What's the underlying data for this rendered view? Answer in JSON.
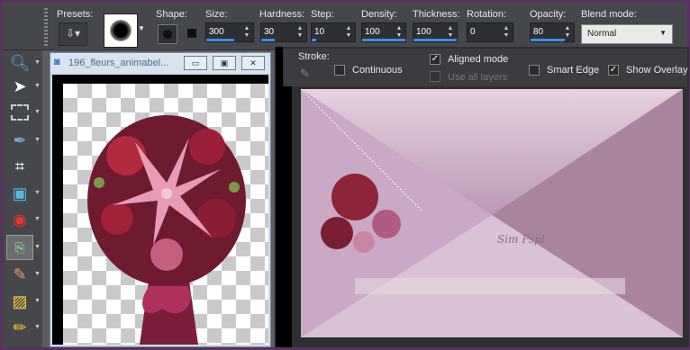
{
  "options": {
    "presets_label": "Presets:",
    "shape_label": "Shape:",
    "size_label": "Size:",
    "size_value": "300",
    "hardness_label": "Hardness:",
    "hardness_value": "30",
    "step_label": "Step:",
    "step_value": "10",
    "density_label": "Density:",
    "density_value": "100",
    "thickness_label": "Thickness:",
    "thickness_value": "100",
    "rotation_label": "Rotation:",
    "rotation_value": "0",
    "opacity_label": "Opacity:",
    "opacity_value": "80",
    "blend_label": "Blend mode:",
    "blend_value": "Normal"
  },
  "stroke_panel": {
    "title": "Stroke:",
    "continuous": "Continuous",
    "aligned": "Aligned mode",
    "use_all_layers": "Use all layers",
    "smart_edge": "Smart Edge",
    "show_overlay": "Show Overlay"
  },
  "left_window": {
    "title": "196_fleurs_animabel..."
  },
  "canvas": {
    "watermark": "Sim Pspl",
    "accent": "#3d8ee6"
  },
  "colors": {
    "frame": "#5a2f61",
    "panel": "#45474b"
  }
}
